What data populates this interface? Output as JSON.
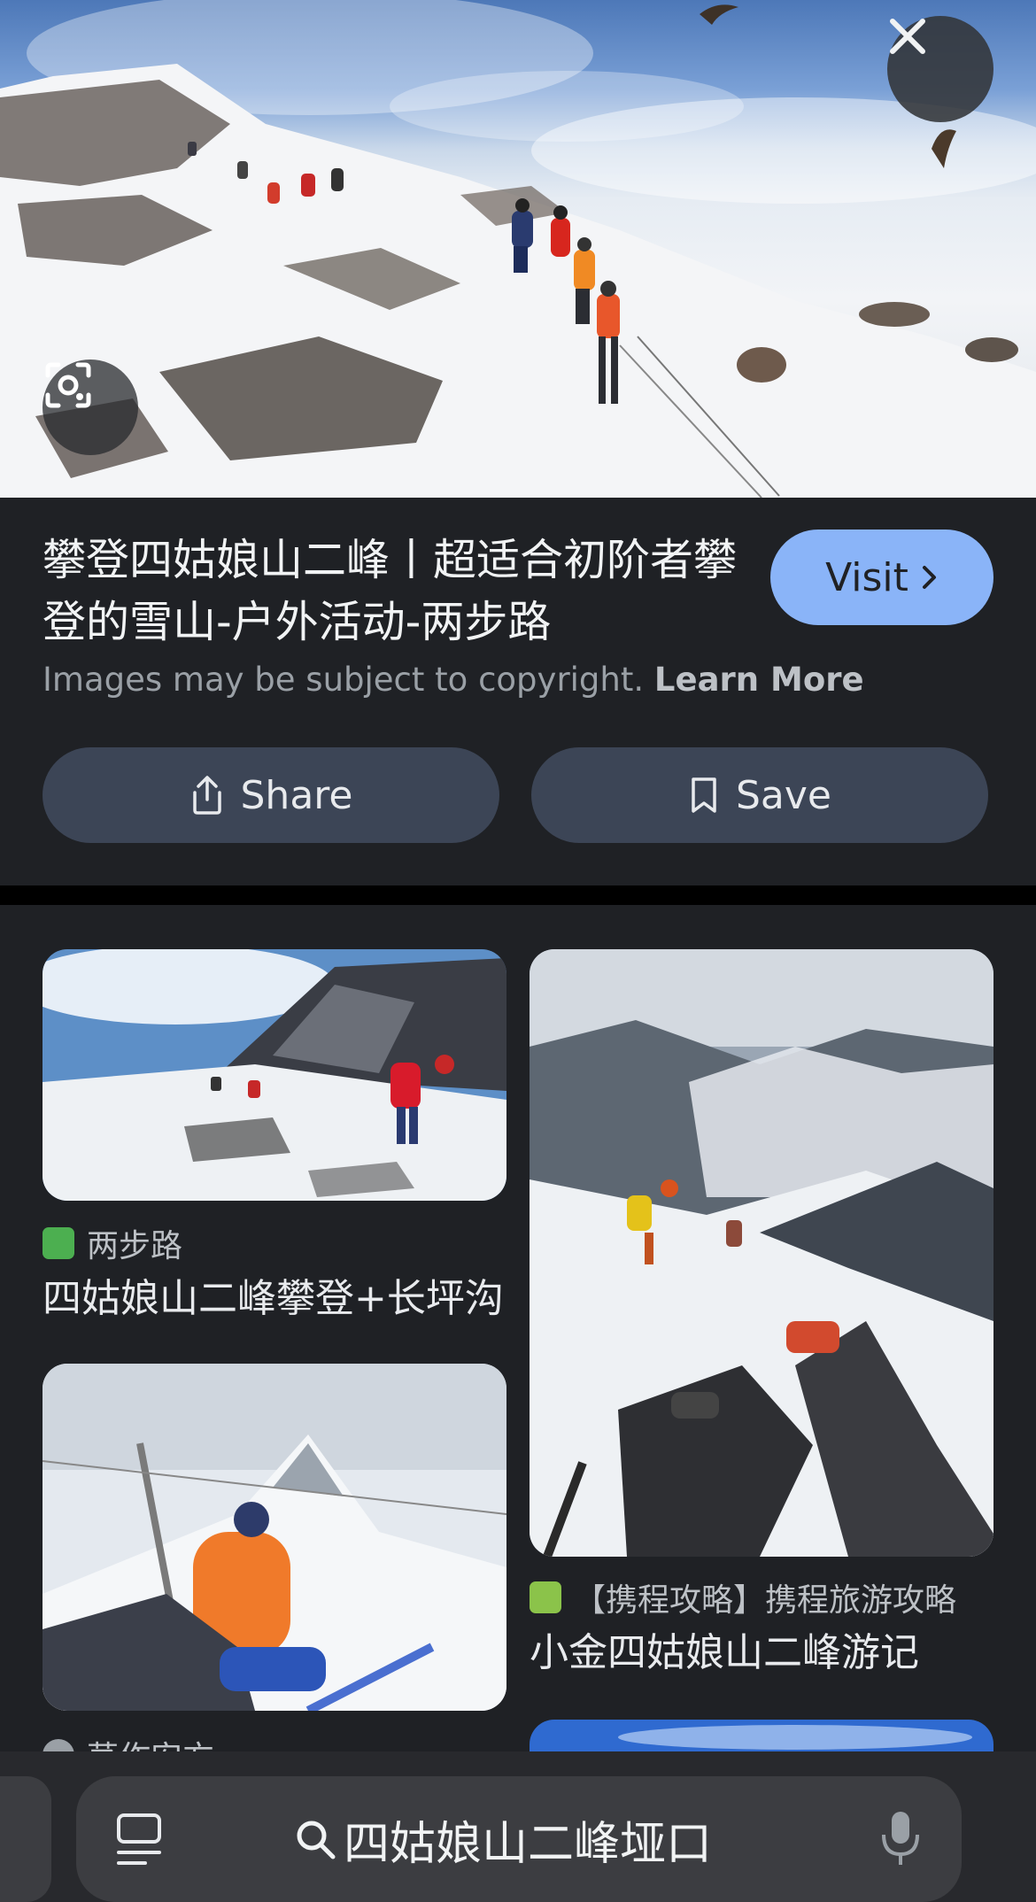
{
  "viewer": {
    "title": "攀登四姑娘山二峰丨超适合初阶者攀登的雪山-户外活动-两步路",
    "visit_label": "Visit",
    "copyright_text": "Images may be subject to copyright.",
    "learn_more_label": "Learn More",
    "share_label": "Share",
    "save_label": "Save"
  },
  "related": [
    {
      "source": "两步路",
      "caption": "四姑娘山二峰攀登+长坪沟",
      "favicon_color": "#4caf50"
    },
    {
      "source": "【携程攻略】携程旅游攻略",
      "caption": "小金四姑娘山二峰游记",
      "favicon_color": "#8bc34a"
    },
    {
      "source": "茅作安方",
      "caption": ""
    }
  ],
  "search": {
    "query": "四姑娘山二峰垭口"
  },
  "colors": {
    "background": "#1f2125",
    "visit_button": "#8ab4f8",
    "pill_button": "#3c4556",
    "bottom_bar": "#28292d"
  },
  "icons": {
    "close": "close-icon",
    "lens": "lens-icon",
    "share": "share-icon",
    "save": "bookmark-icon",
    "menu": "tabs-menu-icon",
    "search": "search-icon",
    "mic": "mic-icon"
  }
}
